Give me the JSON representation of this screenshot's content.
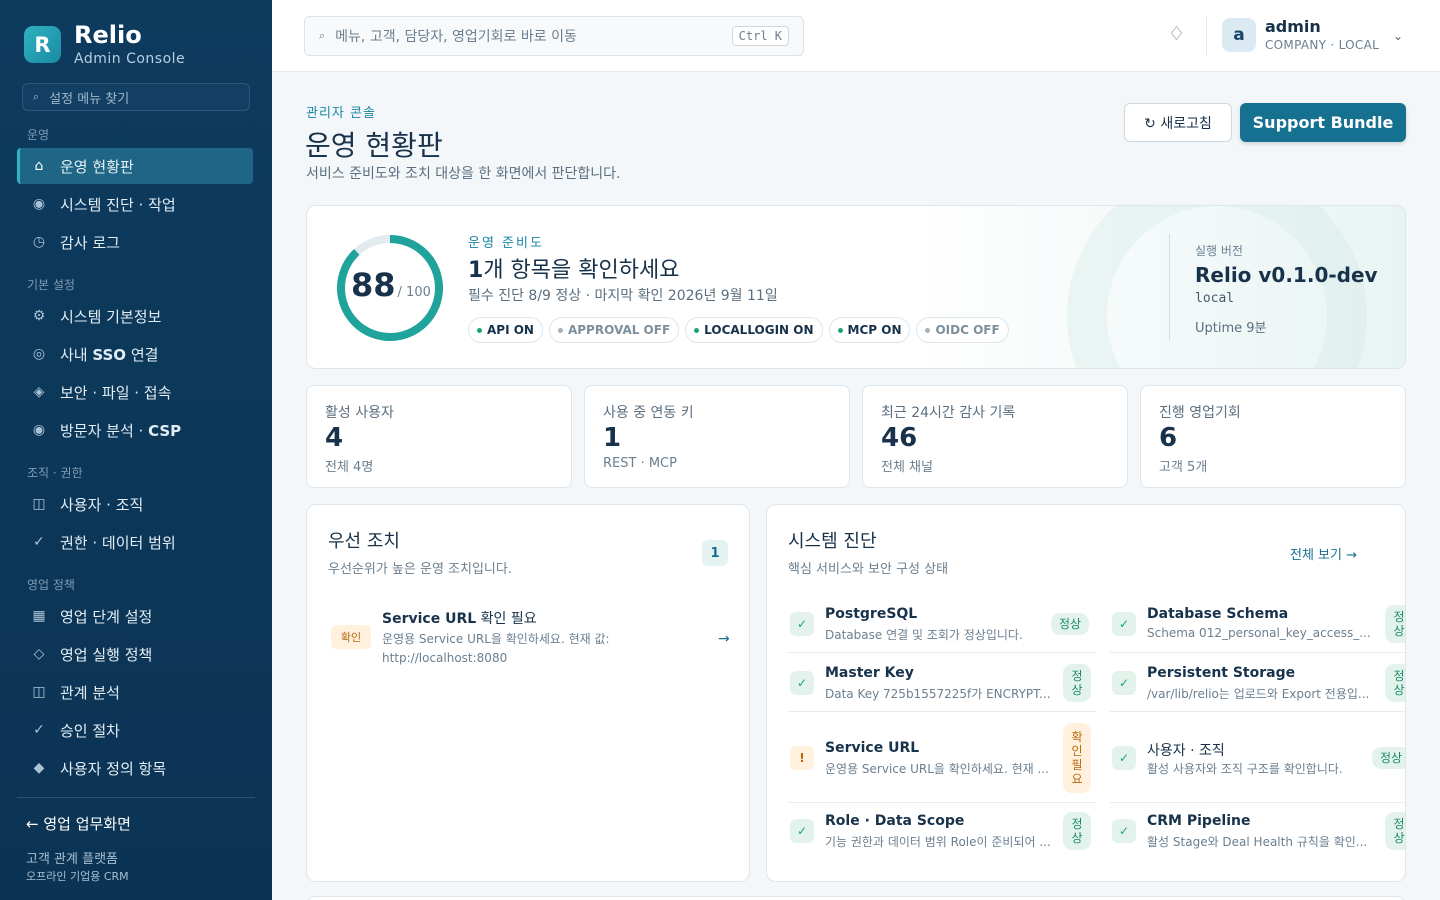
{
  "sidebar": {
    "brand_letter": "R",
    "brand_name": "Relio",
    "brand_sub": "Admin Console",
    "search_placeholder": "설정 메뉴 찾기",
    "sections": [
      "운영",
      "기본 설정",
      "조직 · 권한",
      "영업 정책"
    ],
    "items": [
      {
        "label": "운영 현황판",
        "icon": "home-icon"
      },
      {
        "label": "시스템 진단 · 작업",
        "icon": "pulse-icon"
      },
      {
        "label": "감사 로그",
        "icon": "clock-icon"
      },
      {
        "label": "시스템 기본정보",
        "icon": "gear-icon"
      },
      {
        "label_prefix": "사내 ",
        "label_bold": "SSO",
        "label_suffix": " 연결",
        "icon": "target-icon"
      },
      {
        "label": "보안 · 파일 · 접속",
        "icon": "shield-diamond-icon"
      },
      {
        "label_prefix": "방문자 분석 · ",
        "label_bold": "CSP",
        "icon": "eye-icon"
      },
      {
        "label": "사용자 · 조직",
        "icon": "panel-icon"
      },
      {
        "label": "권한 · 데이터 범위",
        "icon": "check-icon"
      },
      {
        "label": "영업 단계 설정",
        "icon": "grid-icon"
      },
      {
        "label": "영업 실행 정책",
        "icon": "diamond-outline-icon"
      },
      {
        "label": "관계 분석",
        "icon": "panel-icon"
      },
      {
        "label": "승인 절차",
        "icon": "check-icon"
      },
      {
        "label": "사용자 정의 항목",
        "icon": "diamond-filled-icon"
      }
    ],
    "back_link": "← 영업 업무화면",
    "footer_line1": "고객 관계 플랫폼",
    "footer_line2": "오프라인 기업용 CRM"
  },
  "topbar": {
    "search_placeholder": "메뉴, 고객, 담당자, 영업기회로 바로 이동",
    "shortcut": "Ctrl K",
    "avatar_letter": "a",
    "user_name": "admin",
    "user_role": "COMPANY · LOCAL"
  },
  "page": {
    "breadcrumb": "관리자 콘솔",
    "title": "운영 현황판",
    "subtitle": "서비스 준비도와 조치 대상을 한 화면에서 판단합니다.",
    "refresh_label": "↻ 새로고침",
    "support_label": "Support Bundle"
  },
  "readiness": {
    "score": 88,
    "max_label": "/ 100",
    "label": "운영 준비도",
    "title_num": "1",
    "title_rest": "개 항목을 확인하세요",
    "summary": "필수 진단 8/9 정상 · 마지막 확인 2026년 9월 11일",
    "flags": [
      {
        "label": "API ON",
        "on": true
      },
      {
        "label": "APPROVAL OFF",
        "on": false
      },
      {
        "label": "LOCALLOGIN ON",
        "on": true
      },
      {
        "label": "MCP ON",
        "on": true
      },
      {
        "label": "OIDC OFF",
        "on": false
      }
    ],
    "version_label": "실행 버전",
    "version": "Relio v0.1.0-dev",
    "env": "local",
    "uptime": "Uptime 9분"
  },
  "stats": [
    {
      "label": "활성 사용자",
      "value": "4",
      "sub": "전체 4명"
    },
    {
      "label": "사용 중 연동 키",
      "value": "1",
      "sub": "REST · MCP"
    },
    {
      "label": "최근 24시간 감사 기록",
      "value": "46",
      "sub": "전체 채널"
    },
    {
      "label": "진행 영업기회",
      "value": "6",
      "sub": "고객 5개"
    }
  ],
  "priority": {
    "title": "우선 조치",
    "subtitle": "우선순위가 높은 운영 조치입니다.",
    "count": "1",
    "item": {
      "tag": "확인",
      "title_bold": "Service URL",
      "title_rest": " 확인 필요",
      "desc": "운영용 Service URL을 확인하세요. 현재 값: http://localhost:8080",
      "arrow": "→"
    }
  },
  "diagnostics": {
    "title": "시스템 진단",
    "subtitle": "핵심 서비스와 보안 구성 상태",
    "see_all": "전체 보기 →",
    "items": [
      {
        "name": "PostgreSQL",
        "desc": "Database 연결 및 조회가 정상입니다.",
        "status": "정상",
        "ok": true
      },
      {
        "name": "Database Schema",
        "desc": "Schema 012_personal_key_access_...",
        "status": "정상",
        "ok": true
      },
      {
        "name": "Master Key",
        "desc": "Data Key 725b1557225f가 ENCRYPT...",
        "status": "정상",
        "ok": true
      },
      {
        "name": "Persistent Storage",
        "desc": "/var/lib/relio는 업로드와 Export 전용입...",
        "status": "정상",
        "ok": true
      },
      {
        "name": "Service URL",
        "desc": "운영용 Service URL을 확인하세요. 현재 ...",
        "status": "확인 필요",
        "ok": false
      },
      {
        "name": "사용자 · 조직",
        "desc": "활성 사용자와 조직 구조를 확인합니다.",
        "status": "정상",
        "ok": true
      },
      {
        "name": "Role · Data Scope",
        "desc": "기능 권한과 데이터 범위 Role이 준비되어 ...",
        "status": "정상",
        "ok": true
      },
      {
        "name": "CRM Pipeline",
        "desc": "활성 Stage와 Deal Health 규칙을 확인...",
        "status": "정상",
        "ok": true
      }
    ]
  },
  "colors": {
    "accent": "#16708f",
    "sidebar": "#0d3b5e",
    "ok": "#19a37a",
    "warn": "#b86a0e"
  }
}
